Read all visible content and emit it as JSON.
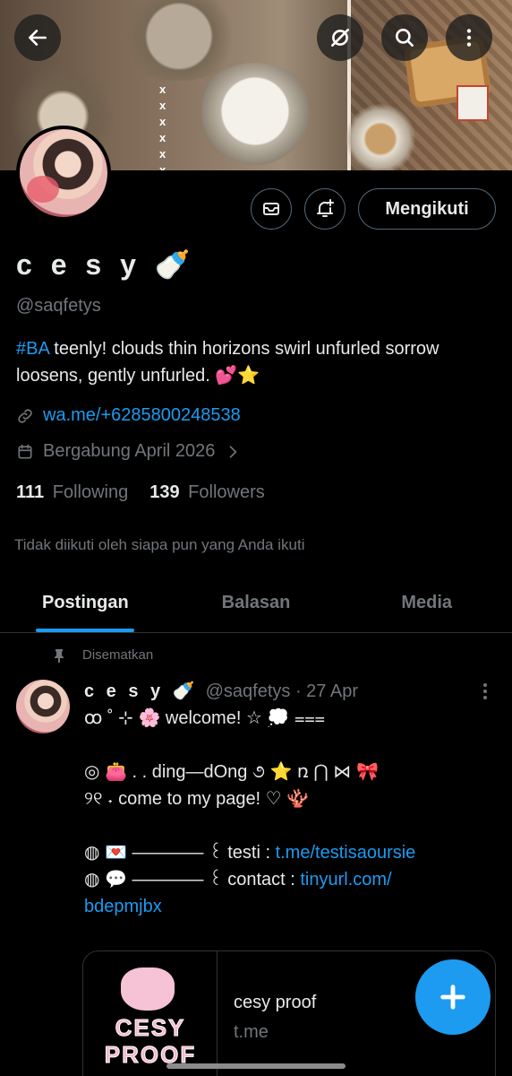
{
  "header": {
    "icons": [
      "back-arrow-icon",
      "translate-off-icon",
      "search-icon",
      "more-vertical-icon"
    ],
    "banner_marks": [
      "x",
      "x",
      "x",
      "x",
      "x",
      "x"
    ]
  },
  "profile": {
    "name": "c e s y 🍼",
    "handle": "@saqfetys",
    "follow_label": "Mengikuti",
    "bio_tag": "#BA",
    "bio_text": " teenly! clouds thin horizons swirl unfurled sorrow loosens, gently unfurled. 💕⭐",
    "link": "wa.me/+6285800248538",
    "joined": "Bergabung April 2026",
    "following_count": "111",
    "following_label": "Following",
    "followers_count": "139",
    "followers_label": "Followers",
    "not_followed": "Tidak diikuti oleh siapa pun yang Anda ikuti"
  },
  "tabs": [
    {
      "label": "Postingan",
      "active": true
    },
    {
      "label": "Balasan",
      "active": false
    },
    {
      "label": "Media",
      "active": false
    }
  ],
  "post": {
    "pinned_label": "Disematkan",
    "name": "c e s y 🍼",
    "handle_date": "@saqfetys · 27 Apr",
    "line1": "ꝏ ˚ ⊹ 🌸 welcome! ☆ 💭 ⩶",
    "line2": "◎ 👛 . . ding—dOng ૭ ⭐  ռ ⋂ ⋈ 🎀",
    "line3": "୨୧ ˖ come to my page!  ♡ 🪸",
    "line4_prefix": "   ◍ 💌 ———— ꒰ testi  : ",
    "line4_link": "t.me/testisaoursie",
    "line5_prefix": "   ◍ 💬 ———— ꒰ contact : ",
    "line5_link": "tinyurl.com/",
    "line6_link": "bdepmjbx"
  },
  "card": {
    "thumb_text": "CESY PROOF",
    "title": "cesy proof",
    "domain": "t.me"
  },
  "colors": {
    "accent": "#1d9bf0",
    "background": "#000000",
    "muted": "#71767b"
  }
}
